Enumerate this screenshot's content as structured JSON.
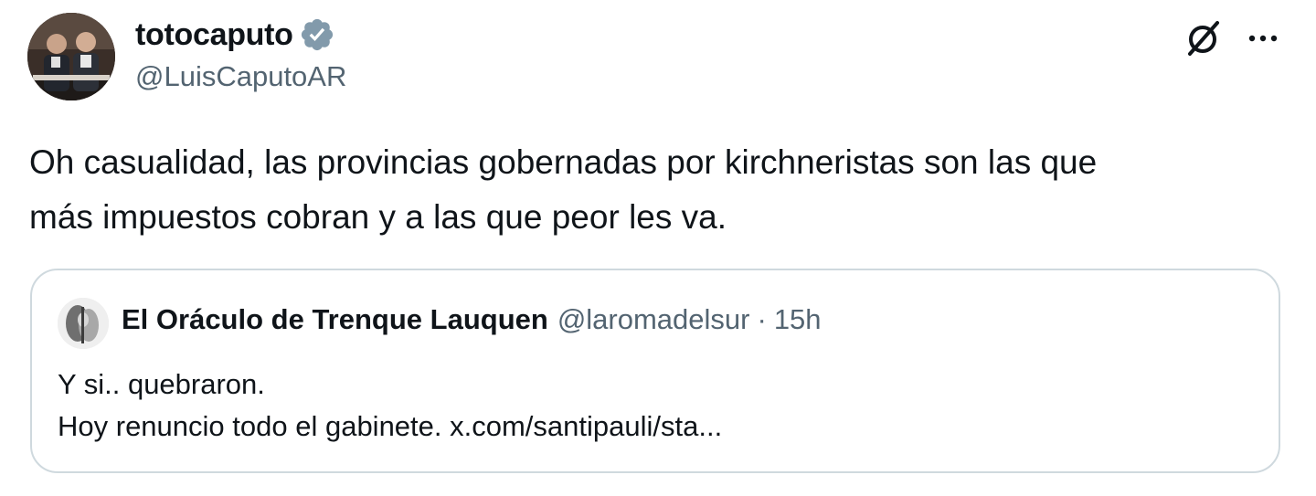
{
  "tweet": {
    "author": {
      "display_name": "totocaputo",
      "handle": "@LuisCaputoAR",
      "verified": true,
      "verified_color": "#829aab"
    },
    "actions": {
      "grok_icon": "grok-icon",
      "more_icon": "more-icon",
      "more_label": "···"
    },
    "text_line1": "Oh casualidad, las provincias gobernadas por kirchneristas son las que",
    "text_line2": "más impuestos cobran y a las que peor les va.",
    "quoted": {
      "display_name": "El Oráculo de Trenque Lauquen",
      "handle": "@laromadelsur",
      "separator": "·",
      "time": "15h",
      "line1": "Y si.. quebraron.",
      "line2": "Hoy renuncio todo el gabinete. x.com/santipauli/sta..."
    }
  },
  "colors": {
    "text_primary": "#0f1419",
    "text_secondary": "#536471",
    "border": "#cfd9de",
    "background": "#ffffff"
  }
}
